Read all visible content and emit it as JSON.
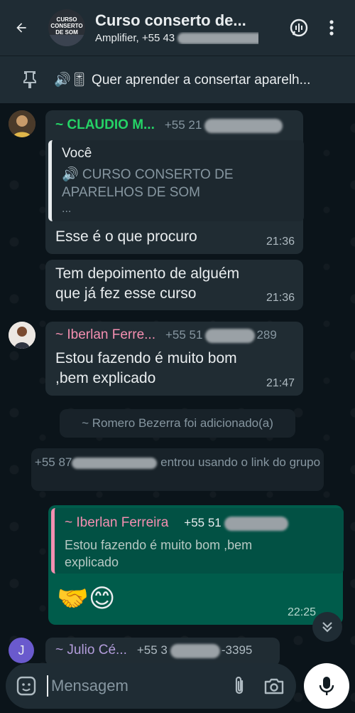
{
  "header": {
    "title": "Curso conserto de...",
    "subtitle": "Amplifier, +55 43 ",
    "avatar_text": "CURSO CONSERTO DE SOM"
  },
  "pinned": {
    "text": "🔊🎚 Quer aprender a consertar aparelh..."
  },
  "messages": [
    {
      "sender": "~ CLAUDIO M...",
      "phone": "+55 21",
      "quote_author": "Você",
      "quote_text": "🔊 CURSO CONSERTO DE APARELHOS DE SOM",
      "quote_more": "...",
      "text": "Esse é o que procuro",
      "time": "21:36"
    },
    {
      "text": "Tem depoimento de alguém que já fez esse curso",
      "time": "21:36"
    },
    {
      "sender": "~ Iberlan Ferre...",
      "phone": "+55 51",
      "phone_end": "289",
      "text": "Estou fazendo é muito bom ,bem explicado",
      "time": "21:47"
    },
    {
      "quote_author": "~ Iberlan Ferreira",
      "quote_phone": "+55 51",
      "quote_text": "Estou fazendo é muito bom ,bem explicado",
      "text": "🤝😊",
      "time": "22:25"
    },
    {
      "sender": "~ Julio Cé...",
      "phone": "+55 3",
      "phone_end": "-3395",
      "avatar_letter": "J"
    }
  ],
  "system": {
    "added": "~ Romero Bezerra foi adicionado(a)",
    "joined_prefix": "+55 87",
    "joined_suffix": "entrou usando o link do grupo"
  },
  "composer": {
    "placeholder": "Mensagem"
  },
  "colors": {
    "header_bg": "#1f2c34",
    "chat_bg": "#0b141a",
    "incoming": "#202c33",
    "outgoing": "#005c4b",
    "claudio_name": "#25d366",
    "iberlan_name": "#f48fb1",
    "julio_name": "#b39ddb"
  }
}
